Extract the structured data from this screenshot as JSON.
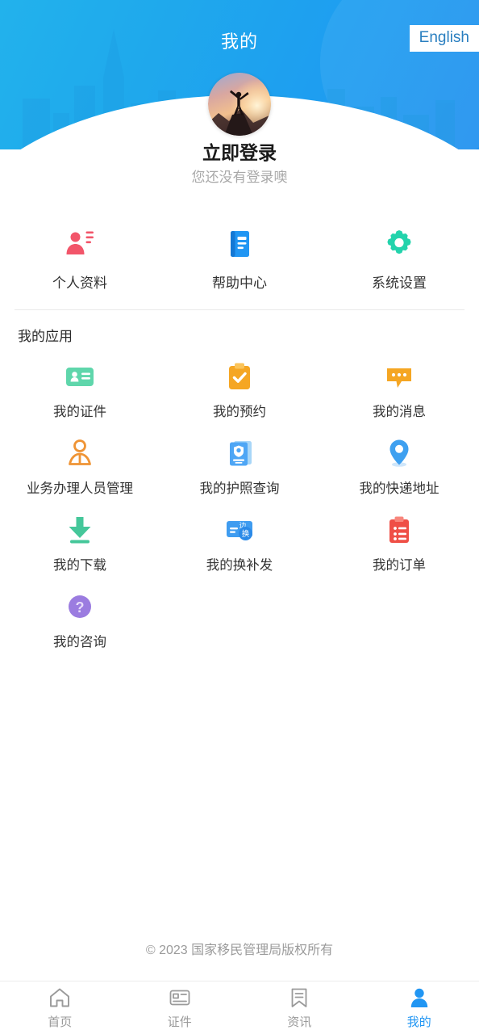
{
  "header": {
    "title": "我的",
    "lang_button": "English",
    "avatar_alt": "person-silhouette-on-mountain-at-sunset",
    "login_name": "立即登录",
    "login_hint": "您还没有登录噢",
    "bg_gradient_from": "#22b2ec",
    "bg_gradient_to": "#2191ef",
    "lang_text_color": "#2a7fc0"
  },
  "quick_actions": [
    {
      "label": "个人资料",
      "icon": "profile-card-icon",
      "color": "#f2556a"
    },
    {
      "label": "帮助中心",
      "icon": "help-book-icon",
      "color": "#2196f3"
    },
    {
      "label": "系统设置",
      "icon": "gear-icon",
      "color": "#23d3ac"
    }
  ],
  "my_apps": {
    "section_title": "我的应用",
    "items": [
      {
        "label": "我的证件",
        "icon": "id-card-icon",
        "color": "#5fd6ab"
      },
      {
        "label": "我的预约",
        "icon": "clipboard-check-icon",
        "color": "#f5a623"
      },
      {
        "label": "我的消息",
        "icon": "message-bubble-icon",
        "color": "#f5a623"
      },
      {
        "label": "业务办理人员管理",
        "icon": "person-outline-icon",
        "color": "#ef9435"
      },
      {
        "label": "我的护照查询",
        "icon": "passport-icon",
        "color": "#4ea6f5"
      },
      {
        "label": "我的快递地址",
        "icon": "location-pin-icon",
        "color": "#3ea0f0"
      },
      {
        "label": "我的下载",
        "icon": "download-icon",
        "color": "#45c79a"
      },
      {
        "label": "我的换补发",
        "icon": "exchange-card-icon",
        "color": "#3f9cf0"
      },
      {
        "label": "我的订单",
        "icon": "order-list-icon",
        "color": "#ef4f46"
      },
      {
        "label": "我的咨询",
        "icon": "question-circle-icon",
        "color": "#9b7ce0"
      }
    ]
  },
  "footer": {
    "copyright": "© 2023 国家移民管理局版权所有"
  },
  "tabbar": {
    "active_color": "#2196f3",
    "inactive_color": "#9a9a9a",
    "items": [
      {
        "label": "首页",
        "icon": "home-icon",
        "active": false
      },
      {
        "label": "证件",
        "icon": "id-card-icon",
        "active": false
      },
      {
        "label": "资讯",
        "icon": "bookmark-icon",
        "active": false
      },
      {
        "label": "我的",
        "icon": "person-icon",
        "active": true
      }
    ]
  }
}
